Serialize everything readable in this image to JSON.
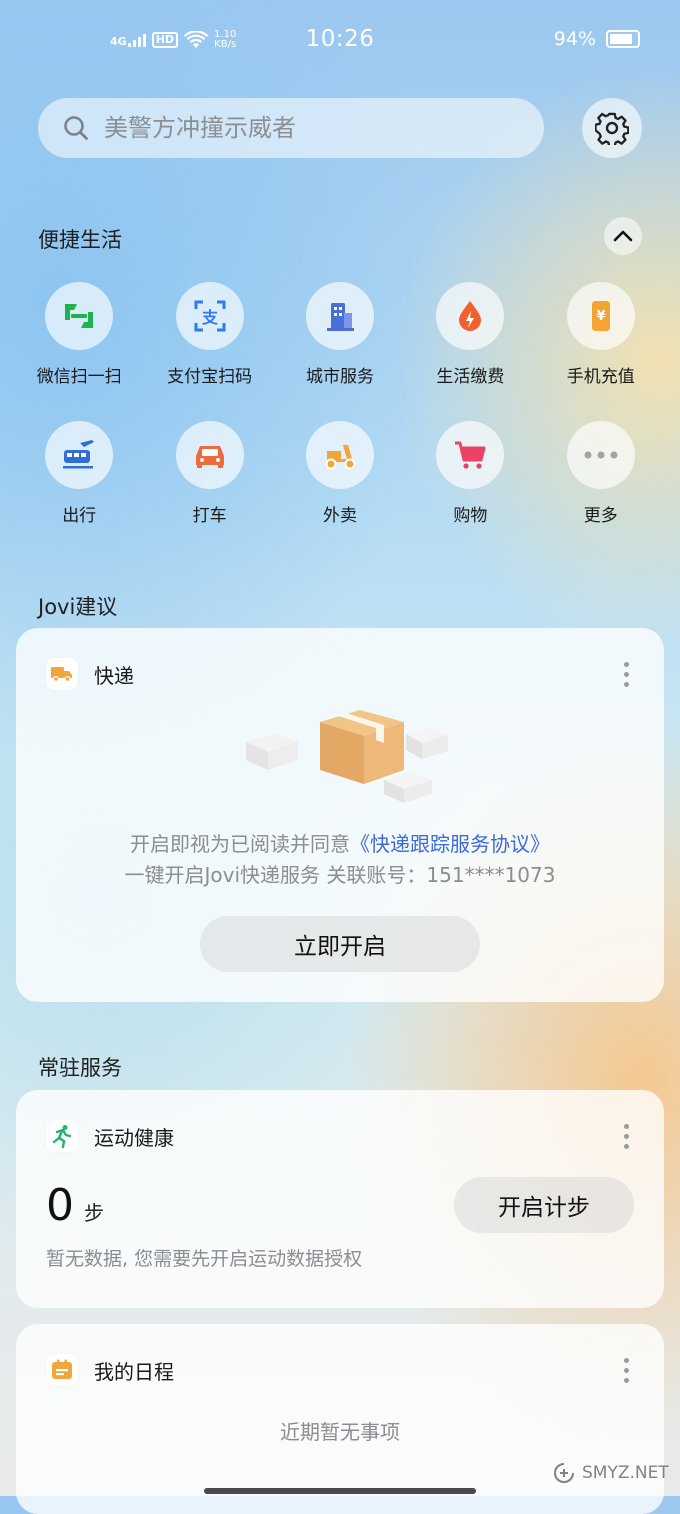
{
  "status_bar": {
    "network": "4G",
    "hd": "HD",
    "speed_value": "1.10",
    "speed_unit": "KB/s",
    "time": "10:26",
    "battery_text": "94%",
    "battery_level": 0.94
  },
  "search": {
    "placeholder": "美警方冲撞示威者"
  },
  "quick_life": {
    "title": "便捷生活",
    "items": [
      {
        "label": "微信扫一扫",
        "icon": "wechat-scan-icon"
      },
      {
        "label": "支付宝扫码",
        "icon": "alipay-scan-icon"
      },
      {
        "label": "城市服务",
        "icon": "city-building-icon"
      },
      {
        "label": "生活缴费",
        "icon": "utility-drop-icon"
      },
      {
        "label": "手机充值",
        "icon": "phone-recharge-icon"
      },
      {
        "label": "出行",
        "icon": "train-plane-icon"
      },
      {
        "label": "打车",
        "icon": "car-icon"
      },
      {
        "label": "外卖",
        "icon": "scooter-icon"
      },
      {
        "label": "购物",
        "icon": "shopping-cart-icon"
      },
      {
        "label": "更多",
        "icon": "more-dots-icon"
      }
    ]
  },
  "jovi": {
    "title": "Jovi建议",
    "card": {
      "title": "快递",
      "consent_prefix": "开启即视为已阅读并同意",
      "consent_link": "《快递跟踪服务协议》",
      "description": "一键开启Jovi快递服务 关联账号：151****1073",
      "button": "立即开启"
    }
  },
  "resident": {
    "title": "常驻服务",
    "health": {
      "title": "运动健康",
      "steps": "0",
      "steps_unit": "步",
      "button": "开启计步",
      "note": "暂无数据, 您需要先开启运动数据授权"
    },
    "schedule": {
      "title": "我的日程",
      "empty": "近期暂无事项"
    }
  },
  "watermark": "SMYZ.NET",
  "colors": {
    "accent_link": "#3d6bd6",
    "health_green": "#1fb56b",
    "calendar_orange": "#f0a63a"
  }
}
